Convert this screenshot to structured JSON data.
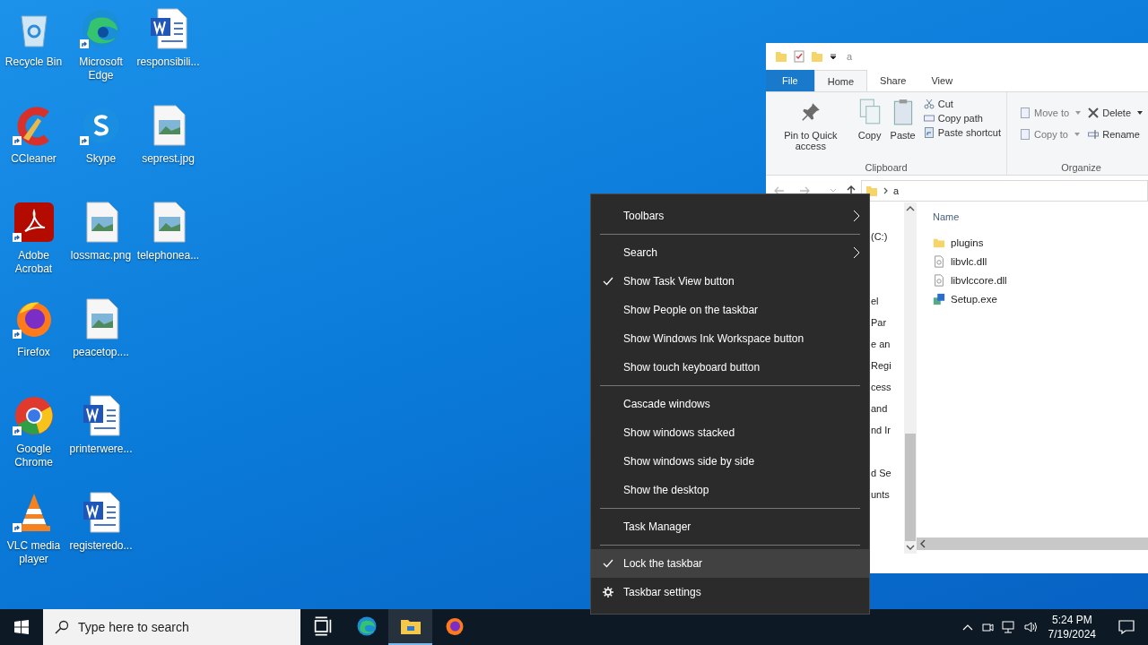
{
  "desktop_icons": [
    {
      "label": "Recycle Bin",
      "kind": "recycle",
      "shortcut": false
    },
    {
      "label": "CCleaner",
      "kind": "ccleaner",
      "shortcut": true
    },
    {
      "label": "Adobe Acrobat",
      "kind": "acrobat",
      "shortcut": true
    },
    {
      "label": "Firefox",
      "kind": "firefox",
      "shortcut": true
    },
    {
      "label": "Google Chrome",
      "kind": "chrome",
      "shortcut": true
    },
    {
      "label": "VLC media player",
      "kind": "vlc",
      "shortcut": true
    },
    {
      "label": "Microsoft Edge",
      "kind": "edge",
      "shortcut": true
    },
    {
      "label": "Skype",
      "kind": "skype",
      "shortcut": true
    },
    {
      "label": "lossmac.png",
      "kind": "image",
      "shortcut": false
    },
    {
      "label": "peacetop....",
      "kind": "image",
      "shortcut": false
    },
    {
      "label": "printerwere...",
      "kind": "word",
      "shortcut": false
    },
    {
      "label": "registeredo...",
      "kind": "word",
      "shortcut": false
    },
    {
      "label": "responsibili...",
      "kind": "word",
      "shortcut": false
    },
    {
      "label": "seprest.jpg",
      "kind": "image",
      "shortcut": false
    },
    {
      "label": "telephonea...",
      "kind": "image",
      "shortcut": false
    }
  ],
  "explorer": {
    "title": "a",
    "tabs": [
      {
        "label": "File",
        "selected": false,
        "kind": "file"
      },
      {
        "label": "Home",
        "selected": true,
        "kind": "tab"
      },
      {
        "label": "Share",
        "selected": false,
        "kind": "tab"
      },
      {
        "label": "View",
        "selected": false,
        "kind": "tab"
      }
    ],
    "clipboard": {
      "pin": "Pin to Quick access",
      "copy": "Copy",
      "paste": "Paste",
      "cut": "Cut",
      "copy_path": "Copy path",
      "paste_shortcut": "Paste shortcut",
      "group": "Clipboard"
    },
    "organize": {
      "move_to": "Move to",
      "copy_to": "Copy to",
      "delete": "Delete",
      "rename": "Rename",
      "group": "Organize"
    },
    "address": "a",
    "nav_fragments": [
      "(C:)",
      "el",
      "Par",
      "e an",
      "Regi",
      "cess",
      "and",
      "nd Ir",
      "d Se",
      "unts"
    ],
    "column": "Name",
    "files": [
      {
        "name": "plugins",
        "kind": "folder"
      },
      {
        "name": "libvlc.dll",
        "kind": "dll"
      },
      {
        "name": "libvlccore.dll",
        "kind": "dll"
      },
      {
        "name": "Setup.exe",
        "kind": "exe"
      }
    ]
  },
  "context_menu": {
    "groups": [
      [
        {
          "label": "Toolbars",
          "kind": "submenu",
          "checked": false,
          "highlighted": false
        }
      ],
      [
        {
          "label": "Search",
          "kind": "submenu",
          "checked": false,
          "highlighted": false
        },
        {
          "label": "Show Task View button",
          "kind": "item",
          "checked": true,
          "highlighted": false
        },
        {
          "label": "Show People on the taskbar",
          "kind": "item",
          "checked": false,
          "highlighted": false
        },
        {
          "label": "Show Windows Ink Workspace button",
          "kind": "item",
          "checked": false,
          "highlighted": false
        },
        {
          "label": "Show touch keyboard button",
          "kind": "item",
          "checked": false,
          "highlighted": false
        }
      ],
      [
        {
          "label": "Cascade windows",
          "kind": "item",
          "checked": false,
          "highlighted": false
        },
        {
          "label": "Show windows stacked",
          "kind": "item",
          "checked": false,
          "highlighted": false
        },
        {
          "label": "Show windows side by side",
          "kind": "item",
          "checked": false,
          "highlighted": false
        },
        {
          "label": "Show the desktop",
          "kind": "item",
          "checked": false,
          "highlighted": false
        }
      ],
      [
        {
          "label": "Task Manager",
          "kind": "item",
          "checked": false,
          "highlighted": false
        }
      ],
      [
        {
          "label": "Lock the taskbar",
          "kind": "item",
          "checked": true,
          "highlighted": true
        },
        {
          "label": "Taskbar settings",
          "kind": "settings",
          "checked": false,
          "highlighted": false
        }
      ]
    ]
  },
  "taskbar": {
    "search_placeholder": "Type here to search",
    "apps": [
      {
        "kind": "taskview",
        "active": false
      },
      {
        "kind": "edge",
        "active": false
      },
      {
        "kind": "explorer",
        "active": true
      },
      {
        "kind": "firefox",
        "active": false
      }
    ],
    "time": "5:24 PM",
    "date": "7/19/2024"
  }
}
